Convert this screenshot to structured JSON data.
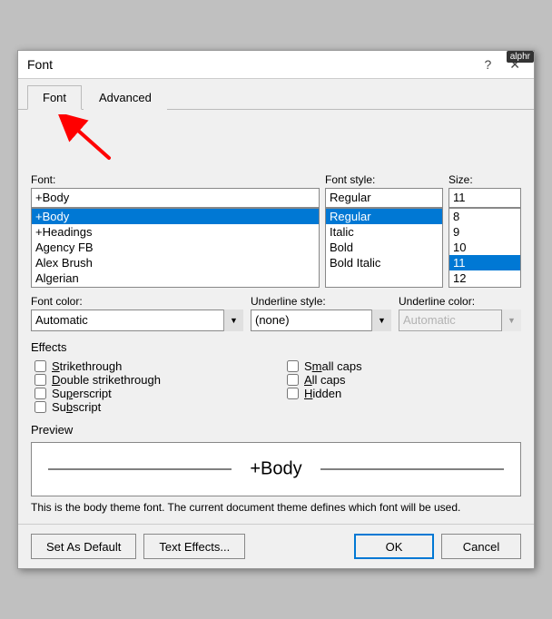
{
  "dialog": {
    "title": "Font",
    "help_btn": "?",
    "close_btn": "✕",
    "alphr_badge": "alphr"
  },
  "tabs": [
    {
      "label": "Font",
      "active": true
    },
    {
      "label": "Advanced",
      "active": false
    }
  ],
  "font_section": {
    "font_label": "Font:",
    "style_label": "Font style:",
    "size_label": "Size:",
    "font_input": "+Body",
    "style_input": "Regular",
    "size_input": "11",
    "font_list": [
      {
        "value": "+Body",
        "selected": true
      },
      {
        "value": "+Headings",
        "selected": false
      },
      {
        "value": "Agency FB",
        "selected": false
      },
      {
        "value": "Alex Brush",
        "selected": false
      },
      {
        "value": "Algerian",
        "selected": false
      }
    ],
    "style_list": [
      {
        "value": "Regular",
        "selected": true
      },
      {
        "value": "Italic",
        "selected": false
      },
      {
        "value": "Bold",
        "selected": false
      },
      {
        "value": "Bold Italic",
        "selected": false
      }
    ],
    "size_list": [
      {
        "value": "8",
        "selected": false
      },
      {
        "value": "9",
        "selected": false
      },
      {
        "value": "10",
        "selected": false
      },
      {
        "value": "11",
        "selected": true
      },
      {
        "value": "12",
        "selected": false
      }
    ]
  },
  "dropdowns": {
    "font_color_label": "Font color:",
    "underline_style_label": "Underline style:",
    "underline_color_label": "Underline color:",
    "font_color_value": "Automatic",
    "underline_style_value": "(none)",
    "underline_color_value": "Automatic"
  },
  "effects": {
    "section_label": "Effects",
    "items_left": [
      {
        "id": "strikethrough",
        "label": "Strikethrough",
        "underline_char": "S",
        "checked": false
      },
      {
        "id": "double_strikethrough",
        "label": "Double strikethrough",
        "underline_char": "D",
        "checked": false
      },
      {
        "id": "superscript",
        "label": "Superscript",
        "underline_char": "P",
        "checked": false
      },
      {
        "id": "subscript",
        "label": "Subscript",
        "underline_char": "b",
        "checked": false
      }
    ],
    "items_right": [
      {
        "id": "small_caps",
        "label": "Small caps",
        "underline_char": "m",
        "checked": false
      },
      {
        "id": "all_caps",
        "label": "All caps",
        "underline_char": "A",
        "checked": false
      },
      {
        "id": "hidden",
        "label": "Hidden",
        "underline_char": "H",
        "checked": false
      }
    ]
  },
  "preview": {
    "section_label": "Preview",
    "preview_text": "+Body",
    "description": "This is the body theme font. The current document theme defines which font will be used."
  },
  "footer": {
    "set_default_label": "Set As Default",
    "text_effects_label": "Text Effects...",
    "ok_label": "OK",
    "cancel_label": "Cancel"
  }
}
